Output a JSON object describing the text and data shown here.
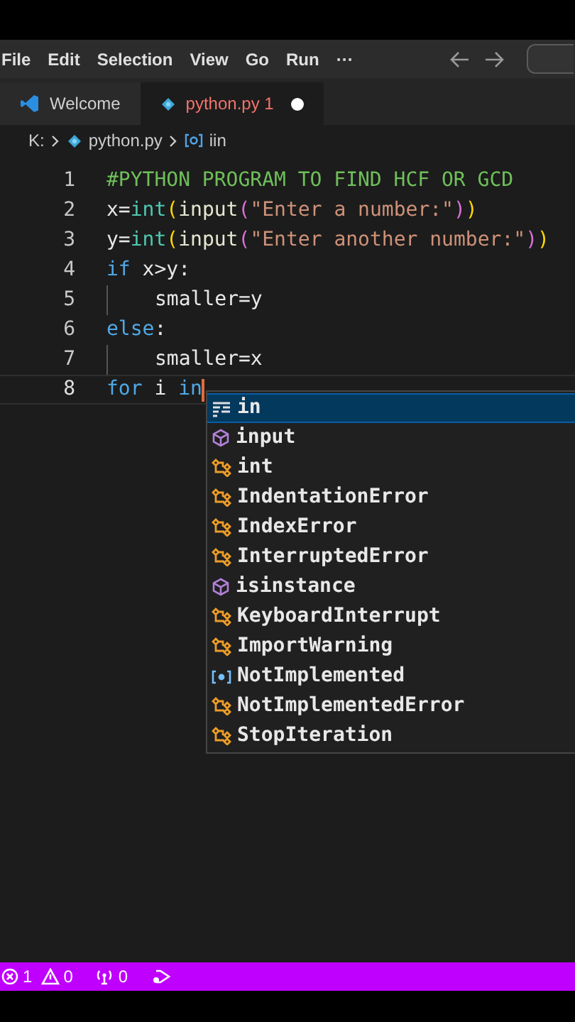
{
  "menu_bar": {
    "items": [
      "File",
      "Edit",
      "Selection",
      "View",
      "Go",
      "Run",
      "···"
    ]
  },
  "tabs": [
    {
      "label": "Welcome",
      "kind": "welcome",
      "selected": false,
      "dirty": false
    },
    {
      "label": "python.py 1",
      "kind": "python",
      "selected": true,
      "dirty": true
    }
  ],
  "breadcrumb": [
    {
      "label": "K:",
      "kind": "folder"
    },
    {
      "label": "python.py",
      "kind": "python"
    },
    {
      "label": "iin",
      "kind": "variable"
    }
  ],
  "code_lines": [
    {
      "number": "1",
      "indent": false,
      "tokens": [
        {
          "text": "#PYTHON PROGRAM TO FIND HCF OR GCD",
          "kind": "comment"
        }
      ]
    },
    {
      "number": "2",
      "indent": false,
      "tokens": [
        {
          "text": "x=",
          "kind": "plain"
        },
        {
          "text": "int",
          "kind": "builtin"
        },
        {
          "text": "(",
          "kind": "bracket1"
        },
        {
          "text": "input",
          "kind": "function"
        },
        {
          "text": "(",
          "kind": "bracket2"
        },
        {
          "text": "\"Enter a number:\"",
          "kind": "string"
        },
        {
          "text": ")",
          "kind": "bracket2"
        },
        {
          "text": ")",
          "kind": "bracket1"
        }
      ]
    },
    {
      "number": "3",
      "indent": false,
      "tokens": [
        {
          "text": "y=",
          "kind": "plain"
        },
        {
          "text": "int",
          "kind": "builtin"
        },
        {
          "text": "(",
          "kind": "bracket1"
        },
        {
          "text": "input",
          "kind": "function"
        },
        {
          "text": "(",
          "kind": "bracket2"
        },
        {
          "text": "\"Enter another number:\"",
          "kind": "string"
        },
        {
          "text": ")",
          "kind": "bracket2"
        },
        {
          "text": ")",
          "kind": "bracket1"
        }
      ]
    },
    {
      "number": "4",
      "indent": false,
      "tokens": [
        {
          "text": "if",
          "kind": "keyword"
        },
        {
          "text": " x>y:",
          "kind": "plain"
        }
      ]
    },
    {
      "number": "5",
      "indent": true,
      "tokens": [
        {
          "text": "smaller=y",
          "kind": "plain"
        }
      ]
    },
    {
      "number": "6",
      "indent": false,
      "tokens": [
        {
          "text": "else",
          "kind": "keyword"
        },
        {
          "text": ":",
          "kind": "plain"
        }
      ]
    },
    {
      "number": "7",
      "indent": true,
      "tokens": [
        {
          "text": "smaller=x",
          "kind": "plain"
        }
      ]
    },
    {
      "number": "8",
      "indent": false,
      "current": true,
      "tokens": [
        {
          "text": "for",
          "kind": "keyword"
        },
        {
          "text": " i ",
          "kind": "plain"
        },
        {
          "text": "in",
          "kind": "keyword"
        }
      ]
    }
  ],
  "suggestions": [
    {
      "label": "**in**",
      "kind": "keyword",
      "selected": true
    },
    {
      "label": "**in**put",
      "kind": "function",
      "selected": false
    },
    {
      "label": "**in**t",
      "kind": "class",
      "selected": false
    },
    {
      "label": "**In**dentationError",
      "kind": "class",
      "selected": false
    },
    {
      "label": "**In**dexError",
      "kind": "class",
      "selected": false
    },
    {
      "label": "**In**terruptedError",
      "kind": "class",
      "selected": false
    },
    {
      "label": "**i**s**in**stance",
      "kind": "function",
      "selected": false
    },
    {
      "label": "Keyboard**In**terrupt",
      "kind": "class",
      "selected": false
    },
    {
      "label": "**I**mportWar**n**ing",
      "kind": "class",
      "selected": false
    },
    {
      "label": "Not**I**mpleme**n**ted",
      "kind": "variable",
      "selected": false
    },
    {
      "label": "Not**I**mpleme**n**tedError",
      "kind": "class",
      "selected": false
    },
    {
      "label": "Stop**I**teratio**n**",
      "kind": "class",
      "selected": false
    }
  ],
  "status_bar": {
    "errors": "1",
    "warnings": "0",
    "ports": "0"
  }
}
